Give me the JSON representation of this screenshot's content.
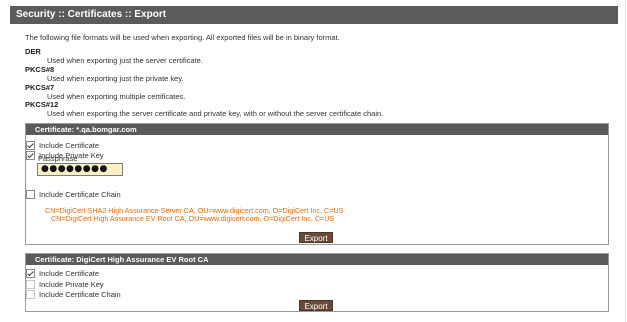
{
  "header": {
    "title": "Security :: Certificates :: Export"
  },
  "intro": "The following file formats will be used when exporting. All exported files will be in binary format.",
  "formats": [
    {
      "name": "DER",
      "description": "Used when exporting just the server certificate."
    },
    {
      "name": "PKCS#8",
      "description": "Used when exporting just the private key."
    },
    {
      "name": "PKCS#7",
      "description": "Used when exporting multiple certificates."
    },
    {
      "name": "PKCS#12",
      "description": "Used when exporting the server certificate and private key, with or without the server certificate chain."
    }
  ],
  "certificates": [
    {
      "title": "Certificate: *.qa.bomgar.com",
      "include_certificate": {
        "label": "Include Certificate",
        "checked": true
      },
      "include_private_key": {
        "label": "Include Private Key",
        "checked": true
      },
      "passphrase_label": "Passphrase",
      "passphrase_value": "●●●●●●●●",
      "include_chain": {
        "label": "Include Certificate Chain",
        "checked": false
      },
      "chain": [
        "CN=DigiCert SHA2 High Assurance Server CA, OU=www.digicert.com, O=DigiCert Inc, C=US",
        "CN=DigiCert High Assurance EV Root CA, OU=www.digicert.com, O=DigiCert Inc, C=US"
      ],
      "export_label": "Export"
    },
    {
      "title": "Certificate: DigiCert High Assurance EV Root CA",
      "include_certificate": {
        "label": "Include Certificate",
        "checked": true
      },
      "include_private_key": {
        "label": "Include Private Key",
        "checked": false
      },
      "include_chain": {
        "label": "Include Certificate Chain",
        "checked": false
      },
      "export_label": "Export"
    }
  ],
  "colors": {
    "header_bg": "#5b5b5b",
    "chain_text": "#ef6a00",
    "button_bg": "#6b4a3a",
    "passphrase_bg": "#fdf0c6"
  }
}
